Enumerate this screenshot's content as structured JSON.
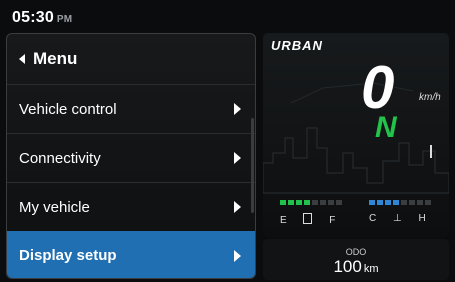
{
  "status": {
    "time": "05:30",
    "ampm": "PM"
  },
  "menu": {
    "title": "Menu",
    "items": [
      {
        "label": "Vehicle control"
      },
      {
        "label": "Connectivity"
      },
      {
        "label": "My vehicle"
      },
      {
        "label": "Display setup",
        "selected": true
      }
    ]
  },
  "cluster": {
    "mode": "URBAN",
    "speed": "0",
    "speed_unit": "km/h",
    "gear": "N",
    "fuel": {
      "empty_label": "E",
      "full_label": "F",
      "level": 0.5
    },
    "temperature": {
      "cold_label": "C",
      "hot_label": "H",
      "level": 0.5
    },
    "colors": {
      "gear": "#22c34b",
      "fuel": "#21c24b",
      "temperature": "#2e86d6"
    }
  },
  "odometer": {
    "label": "ODO",
    "value": "100",
    "unit": "km"
  },
  "colors": {
    "selected": "#1f6fb2"
  }
}
